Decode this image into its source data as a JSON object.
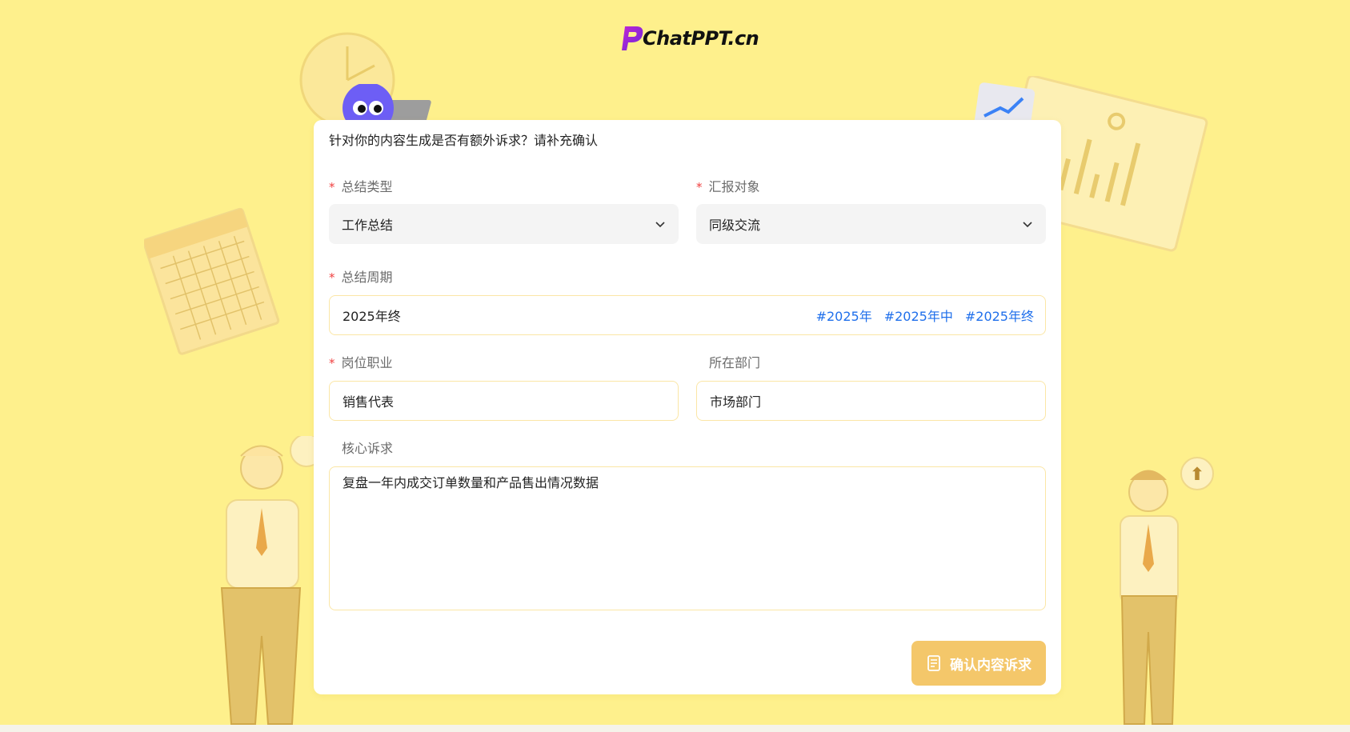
{
  "brand": {
    "logo_text": "ChatPPT.cn"
  },
  "form": {
    "title": "针对你的内容生成是否有额外诉求？请补充确认",
    "summary_type": {
      "label": "总结类型",
      "required": true,
      "value": "工作总结"
    },
    "report_target": {
      "label": "汇报对象",
      "required": true,
      "value": "同级交流"
    },
    "summary_period": {
      "label": "总结周期",
      "required": true,
      "value": "2025年终",
      "quick_tags": [
        "#2025年",
        "#2025年中",
        "#2025年终"
      ]
    },
    "position": {
      "label": "岗位职业",
      "required": true,
      "value": "销售代表"
    },
    "department": {
      "label": "所在部门",
      "required": false,
      "value": "市场部门"
    },
    "core_request": {
      "label": "核心诉求",
      "required": false,
      "value": "复盘一年内成交订单数量和产品售出情况数据"
    },
    "submit_label": "确认内容诉求"
  },
  "colors": {
    "background": "#fef08c",
    "accent_button": "#f4c76a",
    "tag_blue": "#1f6feb",
    "required_red": "#f04040",
    "input_border": "#fbe6a6"
  },
  "icons": {
    "select_arrow": "chevron-down-icon",
    "submit": "document-icon",
    "logo": "chatppt-logo-icon"
  }
}
